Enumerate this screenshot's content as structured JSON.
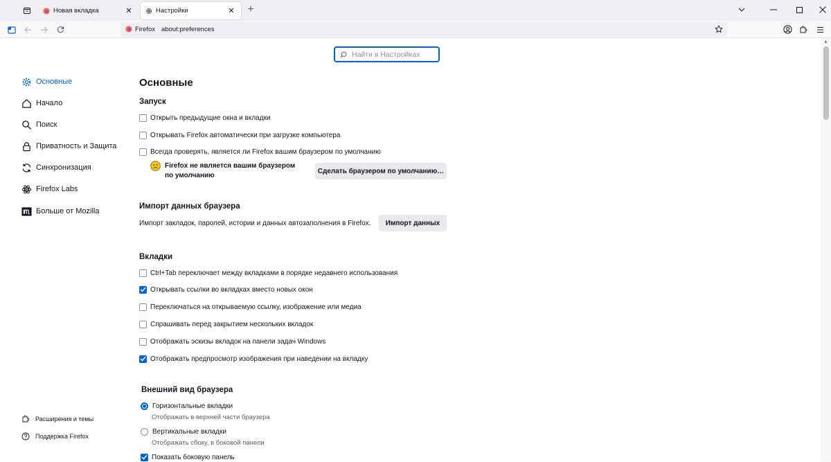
{
  "tabs": [
    {
      "title": "Новая вкладка",
      "active": false
    },
    {
      "title": "Настройки",
      "active": true
    }
  ],
  "urlbar": {
    "identity": "Firefox",
    "url": "about:preferences"
  },
  "search": {
    "placeholder": "Найти в Настройках"
  },
  "sidebar": {
    "categories": [
      {
        "label": "Основные",
        "icon": "gear-icon",
        "selected": true
      },
      {
        "label": "Начало",
        "icon": "home-icon"
      },
      {
        "label": "Поиск",
        "icon": "search-icon"
      },
      {
        "label": "Приватность и Защита",
        "icon": "lock-icon"
      },
      {
        "label": "Синхронизация",
        "icon": "sync-icon"
      },
      {
        "label": "Firefox Labs",
        "icon": "atom-icon"
      },
      {
        "label": "Больше от Mozilla",
        "icon": "mozilla-icon"
      }
    ],
    "footer": [
      {
        "label": "Расширения и темы",
        "icon": "puzzle-icon"
      },
      {
        "label": "Поддержка Firefox",
        "icon": "help-icon"
      }
    ]
  },
  "general": {
    "title": "Основные",
    "startup": {
      "heading": "Запуск",
      "options": [
        {
          "label": "Открыть предыдущие окна и вкладки",
          "checked": false
        },
        {
          "label": "Открывать Firefox автоматически при загрузке компьютера",
          "checked": false
        },
        {
          "label": "Всегда проверять, является ли Firefox вашим браузером по умолчанию",
          "checked": false
        }
      ],
      "not_default_text": "Firefox не является вашим браузером по умолчанию",
      "make_default_button": "Сделать браузером по умолчанию…"
    },
    "import": {
      "heading": "Импорт данных браузера",
      "description": "Импорт закладок, паролей, истории и данных автозаполнения в Firefox.",
      "button": "Импорт данных"
    },
    "tabs": {
      "heading": "Вкладки",
      "options": [
        {
          "label": "Ctrl+Tab переключает между вкладками в порядке недавнего использования",
          "checked": false
        },
        {
          "label": "Открывать ссылки во вкладках вместо новых окон",
          "checked": true
        },
        {
          "label": "Переключаться на открываемую ссылку, изображение или медиа",
          "checked": false
        },
        {
          "label": "Спрашивать перед закрытием нескольких вкладок",
          "checked": false
        },
        {
          "label": "Отображать эскизы вкладок на панели задач Windows",
          "checked": false
        },
        {
          "label": "Отображать предпросмотр изображения при наведении на вкладку",
          "checked": true
        }
      ]
    },
    "appearance": {
      "heading": "Внешний вид браузера",
      "horizontal": {
        "label": "Горизонтальные вкладки",
        "sub": "Отображать в верхней части браузера",
        "checked": true
      },
      "vertical": {
        "label": "Вертикальные вкладки",
        "sub": "Отображать сбоку, в боковой панели",
        "checked": false
      },
      "sidebar_option": {
        "label": "Показать боковую панель",
        "checked": true
      }
    }
  },
  "colors": {
    "accent": "#0061e0",
    "tabstrip": "#f0f0f4"
  }
}
